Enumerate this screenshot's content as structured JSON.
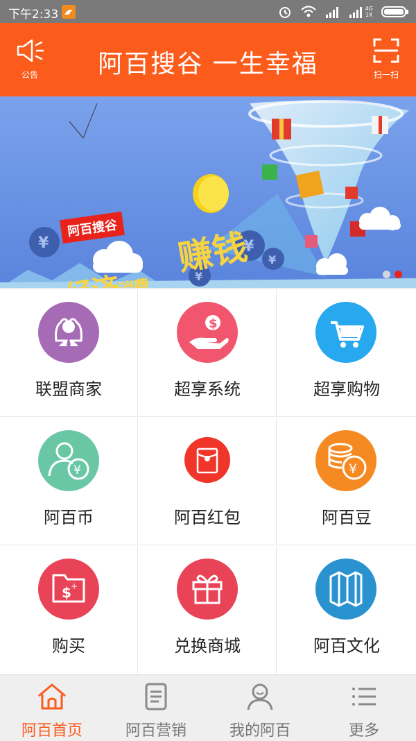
{
  "status_bar": {
    "time": "下午2:33",
    "network": "4G",
    "network_sub": "1X"
  },
  "header": {
    "title": "阿百搜谷 一生幸福",
    "left_button": "公告",
    "right_button": "扫一扫",
    "color": "#fb5b1b"
  },
  "banner": {
    "tag": "阿百搜谷",
    "headline_part1": "分享",
    "headline_part2": "经济",
    "headline_part3": "消费",
    "headline_part4": "赚钱",
    "slides": 2,
    "active_slide": 2
  },
  "grid": {
    "items": [
      {
        "label": "联盟商家",
        "icon": "merchant-group-icon",
        "color": "#a66bb5"
      },
      {
        "label": "超享系统",
        "icon": "hand-money-icon",
        "color": "#f2566e"
      },
      {
        "label": "超享购物",
        "icon": "shopping-cart-icon",
        "color": "#28a8ee"
      },
      {
        "label": "阿百币",
        "icon": "user-coin-icon",
        "color": "#6ac7a6"
      },
      {
        "label": "阿百红包",
        "icon": "red-envelope-icon",
        "color": "#f0362b"
      },
      {
        "label": "阿百豆",
        "icon": "coin-stack-icon",
        "color": "#f68a22"
      },
      {
        "label": "购买",
        "icon": "folder-money-icon",
        "color": "#e84356"
      },
      {
        "label": "兑换商城",
        "icon": "gift-icon",
        "color": "#e84356"
      },
      {
        "label": "阿百文化",
        "icon": "map-icon",
        "color": "#2a92cf"
      }
    ]
  },
  "tabbar": {
    "tabs": [
      {
        "label": "阿百首页",
        "icon": "home-icon",
        "active": true
      },
      {
        "label": "阿百营销",
        "icon": "document-icon",
        "active": false
      },
      {
        "label": "我的阿百",
        "icon": "user-icon",
        "active": false
      },
      {
        "label": "更多",
        "icon": "list-icon",
        "active": false
      }
    ]
  }
}
